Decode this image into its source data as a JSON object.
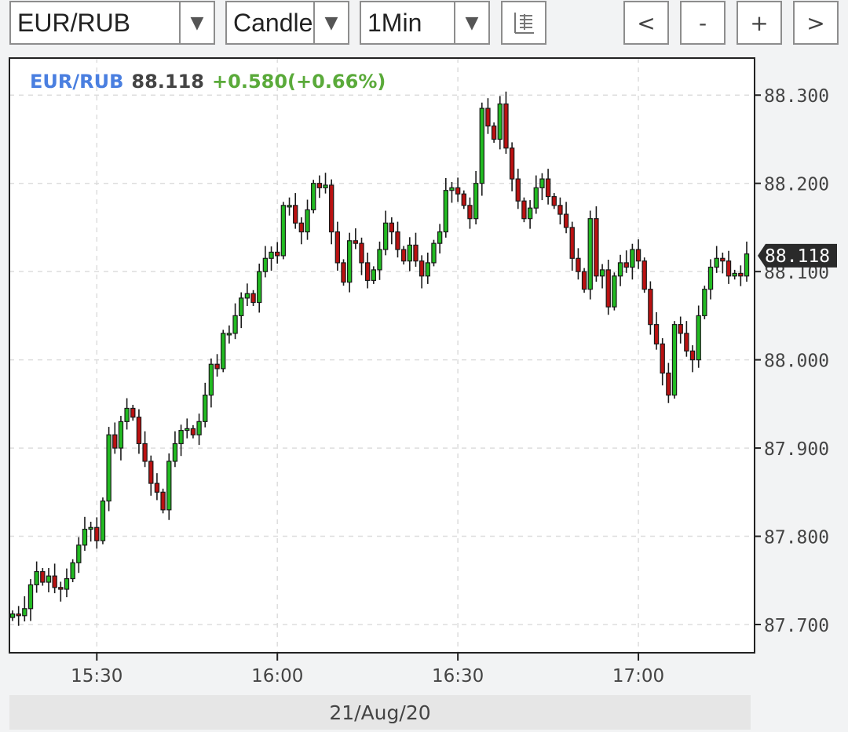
{
  "toolbar": {
    "symbol": "EUR/RUB",
    "chart_type": "Candle",
    "interval": "1Min",
    "dropdown_arrow": "▼",
    "scroll_left": "<",
    "zoom_out": "-",
    "zoom_in": "+",
    "scroll_right": ">"
  },
  "header": {
    "symbol": "EUR/RUB",
    "price": "88.118",
    "change": "+0.580(+0.66%)"
  },
  "current_price_label": "88.118",
  "date_label": "21/Aug/20",
  "colors": {
    "up": "#22bb22",
    "down": "#bb1111",
    "symbol": "#4a7fe0",
    "price": "#444444",
    "change": "#5aaa3a",
    "grid": "#dddddd",
    "tag": "#2a2a2a"
  },
  "chart_data": {
    "type": "candlestick",
    "title": "",
    "xlabel": "",
    "ylabel": "",
    "ylim": [
      87.668,
      88.342
    ],
    "y_ticks": [
      "88.300",
      "88.200",
      "88.100",
      "88.000",
      "87.900",
      "87.800",
      "87.700"
    ],
    "x_ticks": [
      "15:30",
      "16:00",
      "16:30",
      "17:00"
    ],
    "grid": true,
    "last_price": 88.118,
    "series": [
      {
        "name": "EUR/RUB",
        "x_start": "15:16",
        "interval_min": 1,
        "close": [
          87.712,
          87.71,
          87.718,
          87.745,
          87.76,
          87.748,
          87.755,
          87.742,
          87.74,
          87.752,
          87.77,
          87.79,
          87.808,
          87.81,
          87.795,
          87.84,
          87.915,
          87.9,
          87.93,
          87.945,
          87.935,
          87.905,
          87.885,
          87.86,
          87.85,
          87.83,
          87.885,
          87.905,
          87.92,
          87.922,
          87.915,
          87.93,
          87.96,
          87.995,
          87.99,
          88.03,
          88.03,
          88.05,
          88.07,
          88.075,
          88.065,
          88.1,
          88.115,
          88.122,
          88.118,
          88.175,
          88.175,
          88.155,
          88.145,
          88.17,
          88.2,
          88.195,
          88.198,
          88.145,
          88.11,
          88.088,
          88.135,
          88.132,
          88.11,
          88.09,
          88.102,
          88.125,
          88.155,
          88.145,
          88.125,
          88.112,
          88.13,
          88.112,
          88.095,
          88.11,
          88.132,
          88.145,
          88.192,
          88.195,
          88.188,
          88.175,
          88.16,
          88.2,
          88.285,
          88.265,
          88.25,
          88.29,
          88.24,
          88.205,
          88.18,
          88.16,
          88.172,
          88.195,
          88.205,
          88.185,
          88.175,
          88.165,
          88.15,
          88.115,
          88.1,
          88.08,
          88.16,
          88.095,
          88.102,
          88.06,
          88.095,
          88.11,
          88.105,
          88.125,
          88.112,
          88.08,
          88.04,
          88.018,
          87.985,
          87.96,
          88.04,
          88.03,
          88.01,
          88.0,
          88.05,
          88.08,
          88.105,
          88.115,
          88.112,
          88.095,
          88.098,
          88.095,
          88.12
        ]
      }
    ]
  }
}
